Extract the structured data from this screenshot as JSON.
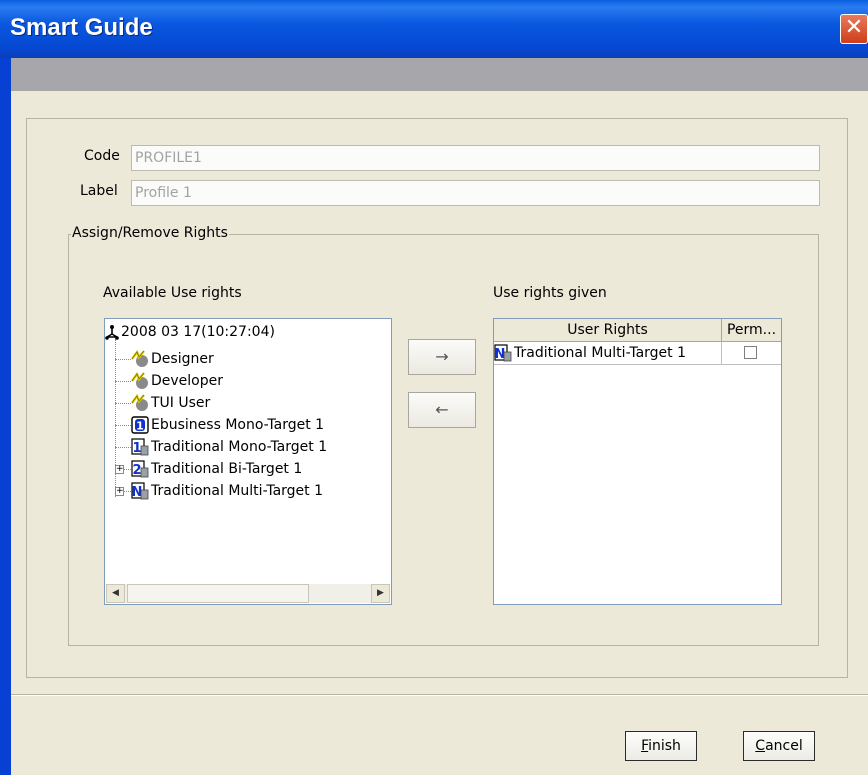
{
  "window": {
    "title": "Smart Guide",
    "close_glyph": "✕"
  },
  "form": {
    "code_label": "Code",
    "code_value": "PROFILE1",
    "label_label": "Label",
    "label_value": "Profile 1"
  },
  "rights_group": {
    "title": "Assign/Remove Rights",
    "available_label": "Available Use rights",
    "given_label": "Use rights given",
    "add_glyph": "→",
    "remove_glyph": "←"
  },
  "tree": {
    "root": {
      "label": "2008 03 17(10:27:04)",
      "icon": "network-root-icon"
    },
    "items": [
      {
        "label": "Designer",
        "icon": "user-role-icon"
      },
      {
        "label": "Developer",
        "icon": "user-role-icon"
      },
      {
        "label": "TUI User",
        "icon": "user-role-icon"
      },
      {
        "label": "Ebusiness Mono-Target 1",
        "icon": "ebusiness-target-icon"
      },
      {
        "label": "Traditional Mono-Target 1",
        "icon": "mono-target-icon"
      },
      {
        "label": "Traditional Bi-Target 1",
        "icon": "bi-target-icon"
      },
      {
        "label": "Traditional Multi-Target 1",
        "icon": "multi-target-icon"
      }
    ]
  },
  "given_table": {
    "columns": [
      "User Rights",
      "Perm..."
    ],
    "rows": [
      {
        "right": "Traditional Multi-Target 1",
        "icon": "multi-target-icon",
        "perm_checked": false
      }
    ]
  },
  "buttons": {
    "finish_mnemonic": "F",
    "finish_rest": "inish",
    "cancel_mnemonic": "C",
    "cancel_rest": "ancel"
  },
  "colors": {
    "titlebar": "#0547d1",
    "window_bg": "#ece9d8",
    "band": "#a7a6aa",
    "close": "#cf3f1a"
  }
}
